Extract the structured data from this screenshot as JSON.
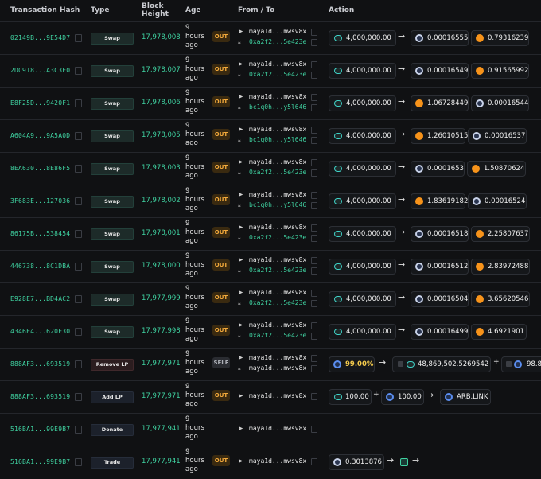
{
  "header": {
    "tx_hash": "Transaction Hash",
    "type": "Type",
    "block_height_1": "Block",
    "block_height_2": "Height",
    "age": "Age",
    "from_to": "From / To",
    "action": "Action"
  },
  "rows": [
    {
      "hash": "02149B...9E54D7",
      "type": "Swap",
      "block": "17,978,008",
      "age": [
        "9",
        "hours",
        "ago"
      ],
      "dir": "OUT",
      "from": "maya1d...mwsv8x",
      "to": "0xa2f2...5e423e",
      "in": "4,000,000.00",
      "out1": "0.00016555",
      "out2": "0.79316239"
    },
    {
      "hash": "2DC918...A3C3E0",
      "type": "Swap",
      "block": "17,978,007",
      "age": [
        "9",
        "hours",
        "ago"
      ],
      "dir": "OUT",
      "from": "maya1d...mwsv8x",
      "to": "0xa2f2...5e423e",
      "in": "4,000,000.00",
      "out1": "0.00016549",
      "out2": "0.91565992"
    },
    {
      "hash": "E8F25D...9420F1",
      "type": "Swap",
      "block": "17,978,006",
      "age": [
        "9",
        "hours",
        "ago"
      ],
      "dir": "OUT",
      "from": "maya1d...mwsv8x",
      "to": "bc1q0h...y5l646",
      "in": "4,000,000.00",
      "out1": "1.06728449",
      "out2": "0.00016544"
    },
    {
      "hash": "A604A9...9A5A0D",
      "type": "Swap",
      "block": "17,978,005",
      "age": [
        "9",
        "hours",
        "ago"
      ],
      "dir": "OUT",
      "from": "maya1d...mwsv8x",
      "to": "bc1q0h...y5l646",
      "in": "4,000,000.00",
      "out1": "1.26010515",
      "out2": "0.00016537"
    },
    {
      "hash": "8EA630...8E86F5",
      "type": "Swap",
      "block": "17,978,003",
      "age": [
        "9",
        "hours",
        "ago"
      ],
      "dir": "OUT",
      "from": "maya1d...mwsv8x",
      "to": "0xa2f2...5e423e",
      "in": "4,000,000.00",
      "out1": "0.0001653",
      "out2": "1.50870624"
    },
    {
      "hash": "3F683E...127036",
      "type": "Swap",
      "block": "17,978,002",
      "age": [
        "9",
        "hours",
        "ago"
      ],
      "dir": "OUT",
      "from": "maya1d...mwsv8x",
      "to": "bc1q0h...y5l646",
      "in": "4,000,000.00",
      "out1": "1.83619182",
      "out2": "0.00016524"
    },
    {
      "hash": "86175B...538454",
      "type": "Swap",
      "block": "17,978,001",
      "age": [
        "9",
        "hours",
        "ago"
      ],
      "dir": "OUT",
      "from": "maya1d...mwsv8x",
      "to": "0xa2f2...5e423e",
      "in": "4,000,000.00",
      "out1": "0.00016518",
      "out2": "2.25807637"
    },
    {
      "hash": "446738...8C1DBA",
      "type": "Swap",
      "block": "17,978,000",
      "age": [
        "9",
        "hours",
        "ago"
      ],
      "dir": "OUT",
      "from": "maya1d...mwsv8x",
      "to": "0xa2f2...5e423e",
      "in": "4,000,000.00",
      "out1": "0.00016512",
      "out2": "2.83972488"
    },
    {
      "hash": "E928E7...BD4AC2",
      "type": "Swap",
      "block": "17,977,999",
      "age": [
        "9",
        "hours",
        "ago"
      ],
      "dir": "OUT",
      "from": "maya1d...mwsv8x",
      "to": "0xa2f2...5e423e",
      "in": "4,000,000.00",
      "out1": "0.00016504",
      "out2": "3.65620546"
    },
    {
      "hash": "4346E4...620E30",
      "type": "Swap",
      "block": "17,977,998",
      "age": [
        "9",
        "hours",
        "ago"
      ],
      "dir": "OUT",
      "from": "maya1d...mwsv8x",
      "to": "0xa2f2...5e423e",
      "in": "4,000,000.00",
      "out1": "0.00016499",
      "out2": "4.6921901"
    },
    {
      "hash": "888AF3...693519",
      "type": "Remove LP",
      "block": "17,977,971",
      "age": [
        "9",
        "hours",
        "ago"
      ],
      "dir": "SELF",
      "from": "maya1d...mwsv8x",
      "to": "maya1d...mwsv8x",
      "pct": "99.00%",
      "out1": "48,869,502.5269542",
      "out2": "98.8"
    },
    {
      "hash": "888AF3...693519",
      "type": "Add LP",
      "block": "17,977,971",
      "age": [
        "9",
        "hours",
        "ago"
      ],
      "dir": "OUT",
      "from": "maya1d...mwsv8x",
      "in": "100.00",
      "in2": "100.00",
      "out1": "ARB.LINK"
    },
    {
      "hash": "516BA1...99E9B7",
      "type": "Donate",
      "block": "17,977,941",
      "age": [
        "9",
        "hours",
        "ago"
      ],
      "dir": "",
      "from": "maya1d...mwsv8x"
    },
    {
      "hash": "516BA1...99E9B7",
      "type": "Trade",
      "block": "17,977,941",
      "age": [
        "9",
        "hours",
        "ago"
      ],
      "dir": "OUT",
      "from": "maya1d...mwsv8x",
      "in": "0.3013876"
    }
  ]
}
